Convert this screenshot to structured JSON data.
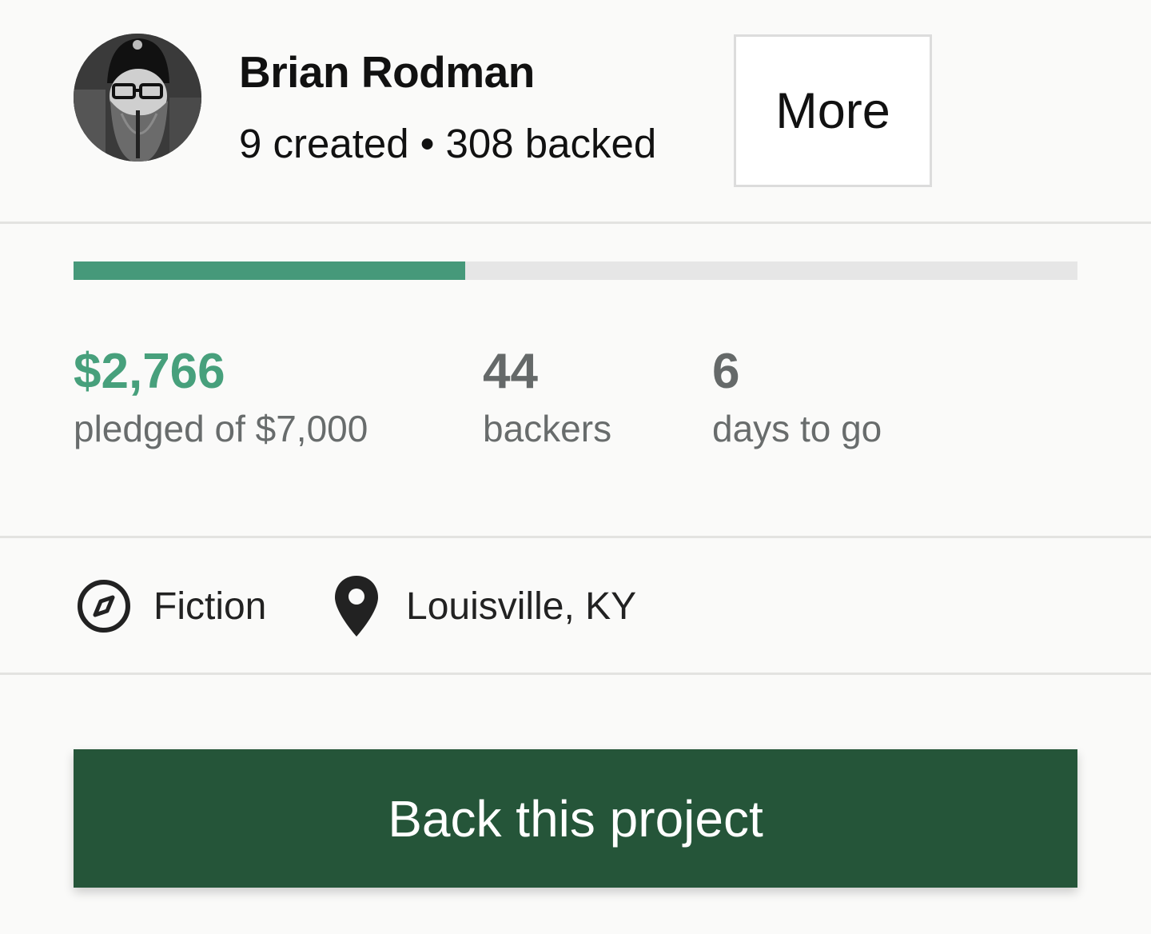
{
  "creator": {
    "name": "Brian Rodman",
    "created": "9 created",
    "separator": "•",
    "backed": "308 backed",
    "more_label": "More"
  },
  "progress": {
    "fraction": 0.39,
    "fill_color": "#46997a",
    "track_color": "#e6e6e6"
  },
  "stats": {
    "pledged_value": "$2,766",
    "pledged_label": "pledged of $7,000",
    "backers_value": "44",
    "backers_label": "backers",
    "days_value": "6",
    "days_label": "days to go"
  },
  "meta": {
    "category_icon": "compass-icon",
    "category": "Fiction",
    "location_icon": "map-pin-icon",
    "location": "Louisville, KY"
  },
  "cta": {
    "label": "Back this project",
    "color": "#255539"
  },
  "colors": {
    "accent_green": "#47a07c",
    "background": "#fafaf9"
  }
}
